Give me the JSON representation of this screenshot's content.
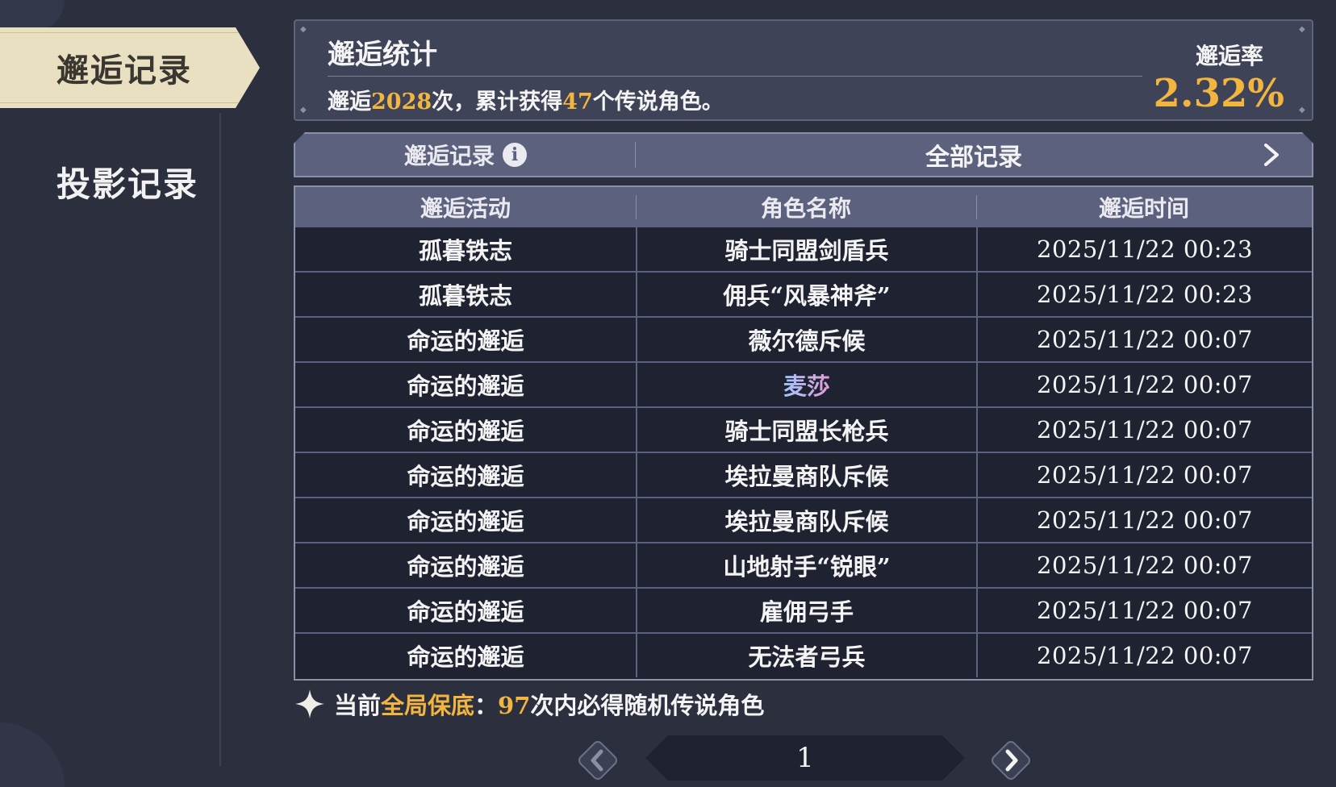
{
  "sidebar": {
    "active_tab": "邂逅记录",
    "tabs": [
      "邂逅记录",
      "投影记录"
    ]
  },
  "stats": {
    "title": "邂逅统计",
    "summary_prefix": "邂逅",
    "total_encounters": "2028",
    "summary_mid": "次，累计获得",
    "legendary_count": "47",
    "summary_suffix": "个传说角色。",
    "rate_label": "邂逅率",
    "rate_value": "2.32%"
  },
  "filter": {
    "label": "邂逅记录",
    "info_icon": "i",
    "selected": "全部记录"
  },
  "table": {
    "headers": [
      "邂逅活动",
      "角色名称",
      "邂逅时间"
    ],
    "rows": [
      {
        "event": "孤暮铁志",
        "character": "骑士同盟剑盾兵",
        "time": "2025/11/22 00:23"
      },
      {
        "event": "孤暮铁志",
        "character": "佣兵“风暴神斧”",
        "time": "2025/11/22 00:23"
      },
      {
        "event": "命运的邂逅",
        "character": "薇尔德斥候",
        "time": "2025/11/22 00:07"
      },
      {
        "event": "命运的邂逅",
        "character": "麦莎",
        "time": "2025/11/22 00:07",
        "rare": true
      },
      {
        "event": "命运的邂逅",
        "character": "骑士同盟长枪兵",
        "time": "2025/11/22 00:07"
      },
      {
        "event": "命运的邂逅",
        "character": "埃拉曼商队斥候",
        "time": "2025/11/22 00:07"
      },
      {
        "event": "命运的邂逅",
        "character": "埃拉曼商队斥候",
        "time": "2025/11/22 00:07"
      },
      {
        "event": "命运的邂逅",
        "character": "山地射手“锐眼”",
        "time": "2025/11/22 00:07"
      },
      {
        "event": "命运的邂逅",
        "character": "雇佣弓手",
        "time": "2025/11/22 00:07"
      },
      {
        "event": "命运的邂逅",
        "character": "无法者弓兵",
        "time": "2025/11/22 00:07"
      }
    ]
  },
  "guarantee": {
    "prefix": "当前",
    "highlight_label": "全局保底",
    "colon": "：",
    "count": "97",
    "suffix": "次内必得随机传说角色"
  },
  "pager": {
    "page": "1"
  },
  "colors": {
    "accent_gold": "#f2b540",
    "background": "#2c2f3e",
    "active_tab": "#e9dfc1",
    "rare_character": "#d896e8"
  },
  "icons": [
    "info-icon",
    "chevron-right-icon",
    "sparkle-icon",
    "chevron-left-icon"
  ]
}
